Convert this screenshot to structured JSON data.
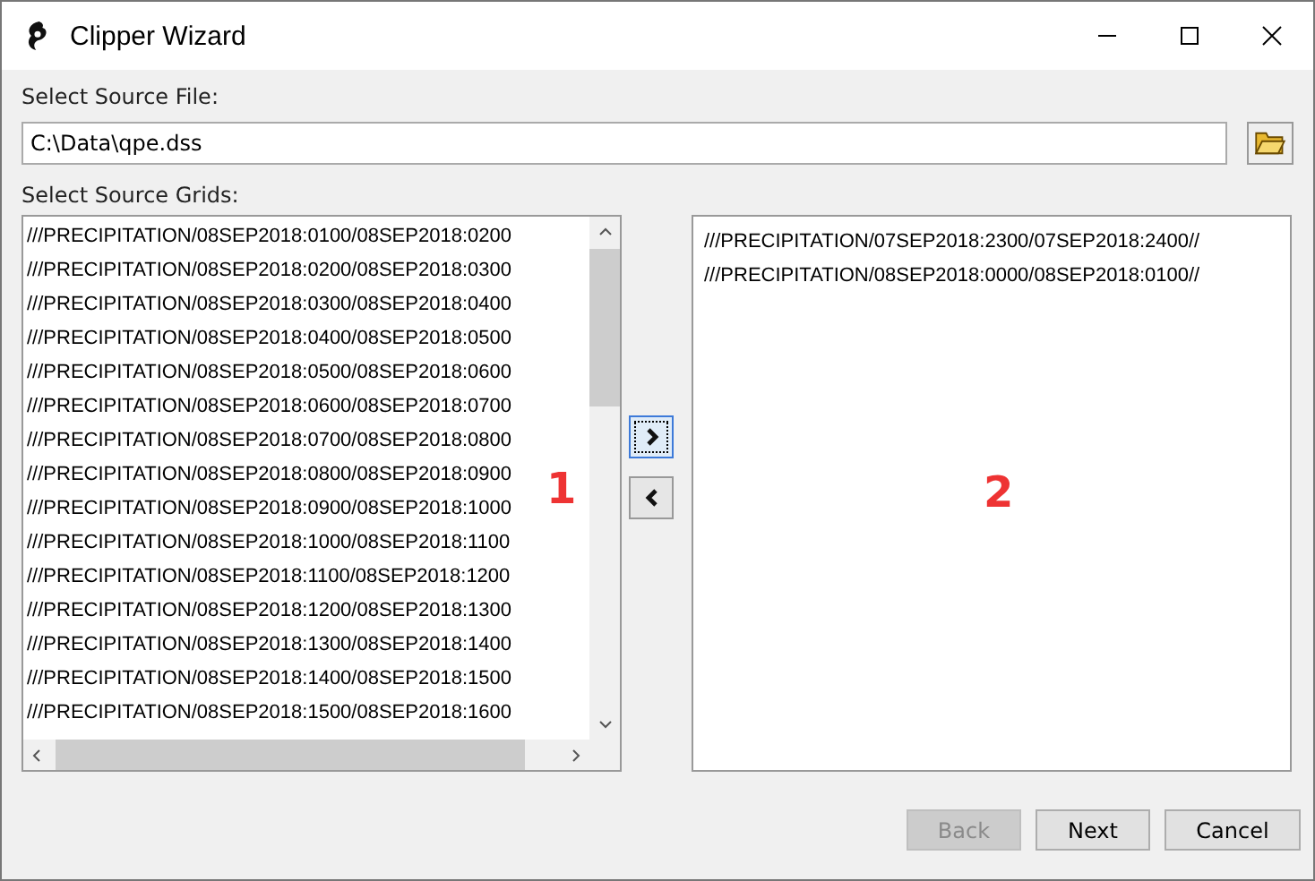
{
  "window": {
    "title": "Clipper Wizard"
  },
  "source_file": {
    "label": "Select Source File:",
    "value": "C:\\Data\\qpe.dss"
  },
  "grids_label": "Select Source Grids:",
  "available_grids": [
    "///PRECIPITATION/08SEP2018:0100/08SEP2018:0200",
    "///PRECIPITATION/08SEP2018:0200/08SEP2018:0300",
    "///PRECIPITATION/08SEP2018:0300/08SEP2018:0400",
    "///PRECIPITATION/08SEP2018:0400/08SEP2018:0500",
    "///PRECIPITATION/08SEP2018:0500/08SEP2018:0600",
    "///PRECIPITATION/08SEP2018:0600/08SEP2018:0700",
    "///PRECIPITATION/08SEP2018:0700/08SEP2018:0800",
    "///PRECIPITATION/08SEP2018:0800/08SEP2018:0900",
    "///PRECIPITATION/08SEP2018:0900/08SEP2018:1000",
    "///PRECIPITATION/08SEP2018:1000/08SEP2018:1100",
    "///PRECIPITATION/08SEP2018:1100/08SEP2018:1200",
    "///PRECIPITATION/08SEP2018:1200/08SEP2018:1300",
    "///PRECIPITATION/08SEP2018:1300/08SEP2018:1400",
    "///PRECIPITATION/08SEP2018:1400/08SEP2018:1500",
    "///PRECIPITATION/08SEP2018:1500/08SEP2018:1600"
  ],
  "selected_grids": [
    "///PRECIPITATION/07SEP2018:2300/07SEP2018:2400//",
    "///PRECIPITATION/08SEP2018:0000/08SEP2018:0100//"
  ],
  "annotations": [
    "1",
    "2"
  ],
  "buttons": [
    {
      "label": "Back",
      "disabled": true
    },
    {
      "label": "Next",
      "disabled": false
    },
    {
      "label": "Cancel",
      "disabled": false
    }
  ]
}
